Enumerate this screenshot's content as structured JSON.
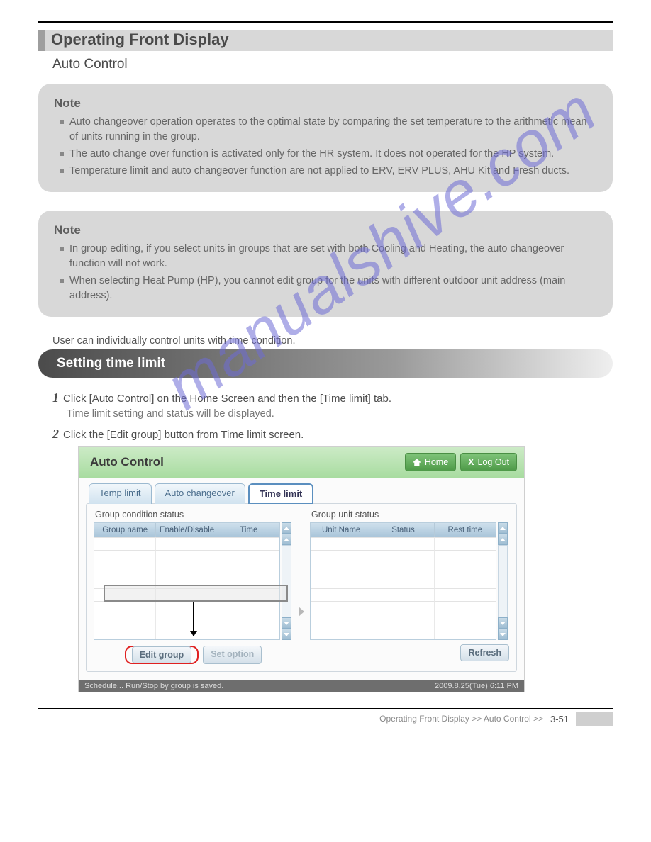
{
  "page": {
    "breadcrumb_footer": "Operating Front Display >> Auto Control >>",
    "page_number": "3-51"
  },
  "ribbon": {
    "title": "Operating Front Display"
  },
  "subtitle": "Auto Control",
  "note1": {
    "heading": "Note",
    "items": [
      "Auto changeover operation operates to the optimal state by comparing the set temperature to the arithmetic mean of units running in the group.",
      "The auto change over function is activated only for the HR system. It does not operated for the HP system.",
      "Temperature limit and auto changeover function are not applied to ERV, ERV PLUS, AHU Kit and Fresh ducts."
    ]
  },
  "note2": {
    "heading": "Note",
    "items": [
      "In group editing, if you select units in groups that are set with both Cooling and Heating, the auto changeover function will not work.",
      "When selecting Heat Pump (HP), you cannot edit group for the units with different outdoor unit address (main address)."
    ]
  },
  "intro_small": "User can individually control units with time condition.",
  "heading_round": "Setting time limit",
  "step1": {
    "line": "Click [Auto Control] on the Home Screen and then the [Time limit] tab.",
    "sub": "Time limit setting and status will be displayed."
  },
  "step2": {
    "line": "Click the [Edit group] button from Time limit screen."
  },
  "shot": {
    "title": "Auto Control",
    "home": "Home",
    "logout": "Log Out",
    "tabs": {
      "temp": "Temp limit",
      "auto": "Auto changeover",
      "time": "Time limit"
    },
    "left_label": "Group condition status",
    "right_label": "Group unit status",
    "left_cols": [
      "Group name",
      "Enable/Disable",
      "Time"
    ],
    "right_cols": [
      "Unit Name",
      "Status",
      "Rest time"
    ],
    "btn_edit": "Edit group",
    "btn_setopt": "Set option",
    "btn_refresh": "Refresh",
    "status_left": "Schedule... Run/Stop by group is saved.",
    "status_right": "2009.8.25(Tue)  6:11 PM"
  },
  "watermark": "manualshive.com"
}
